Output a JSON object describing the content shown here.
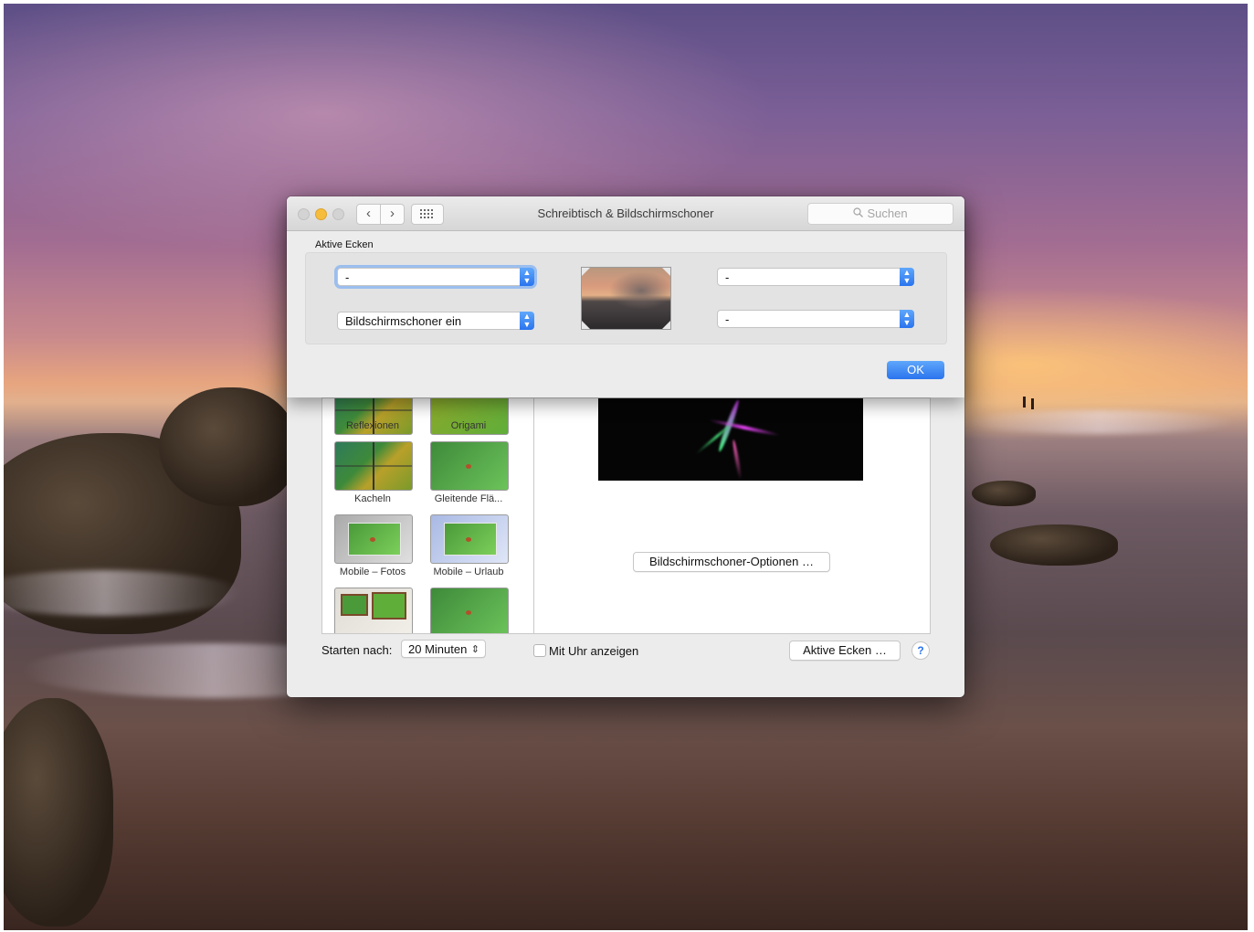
{
  "window": {
    "title": "Schreibtisch & Bildschirmschoner",
    "search_placeholder": "Suchen",
    "nav_back": "‹",
    "nav_forward": "›",
    "grid_icon": "show-all-icon"
  },
  "sheet": {
    "heading": "Aktive Ecken",
    "corners": {
      "top_left": "-",
      "bottom_left": "Bildschirmschoner ein",
      "top_right": "-",
      "bottom_right": "-"
    },
    "ok_label": "OK"
  },
  "screensavers": [
    {
      "label": "Reflexionen"
    },
    {
      "label": "Origami"
    },
    {
      "label": "Kacheln"
    },
    {
      "label": "Gleitende Flä..."
    },
    {
      "label": "Mobile – Fotos"
    },
    {
      "label": "Mobile – Urlaub"
    }
  ],
  "options_button": "Bildschirmschoner-Optionen …",
  "start_after_label": "Starten nach:",
  "start_after_value": "20 Minuten",
  "show_clock_label": "Mit Uhr anzeigen",
  "show_clock_checked": false,
  "hot_corners_button": "Aktive Ecken …",
  "help_label": "?",
  "colors": {
    "accent": "#2a74ee",
    "minimize": "#f5bd3b"
  }
}
